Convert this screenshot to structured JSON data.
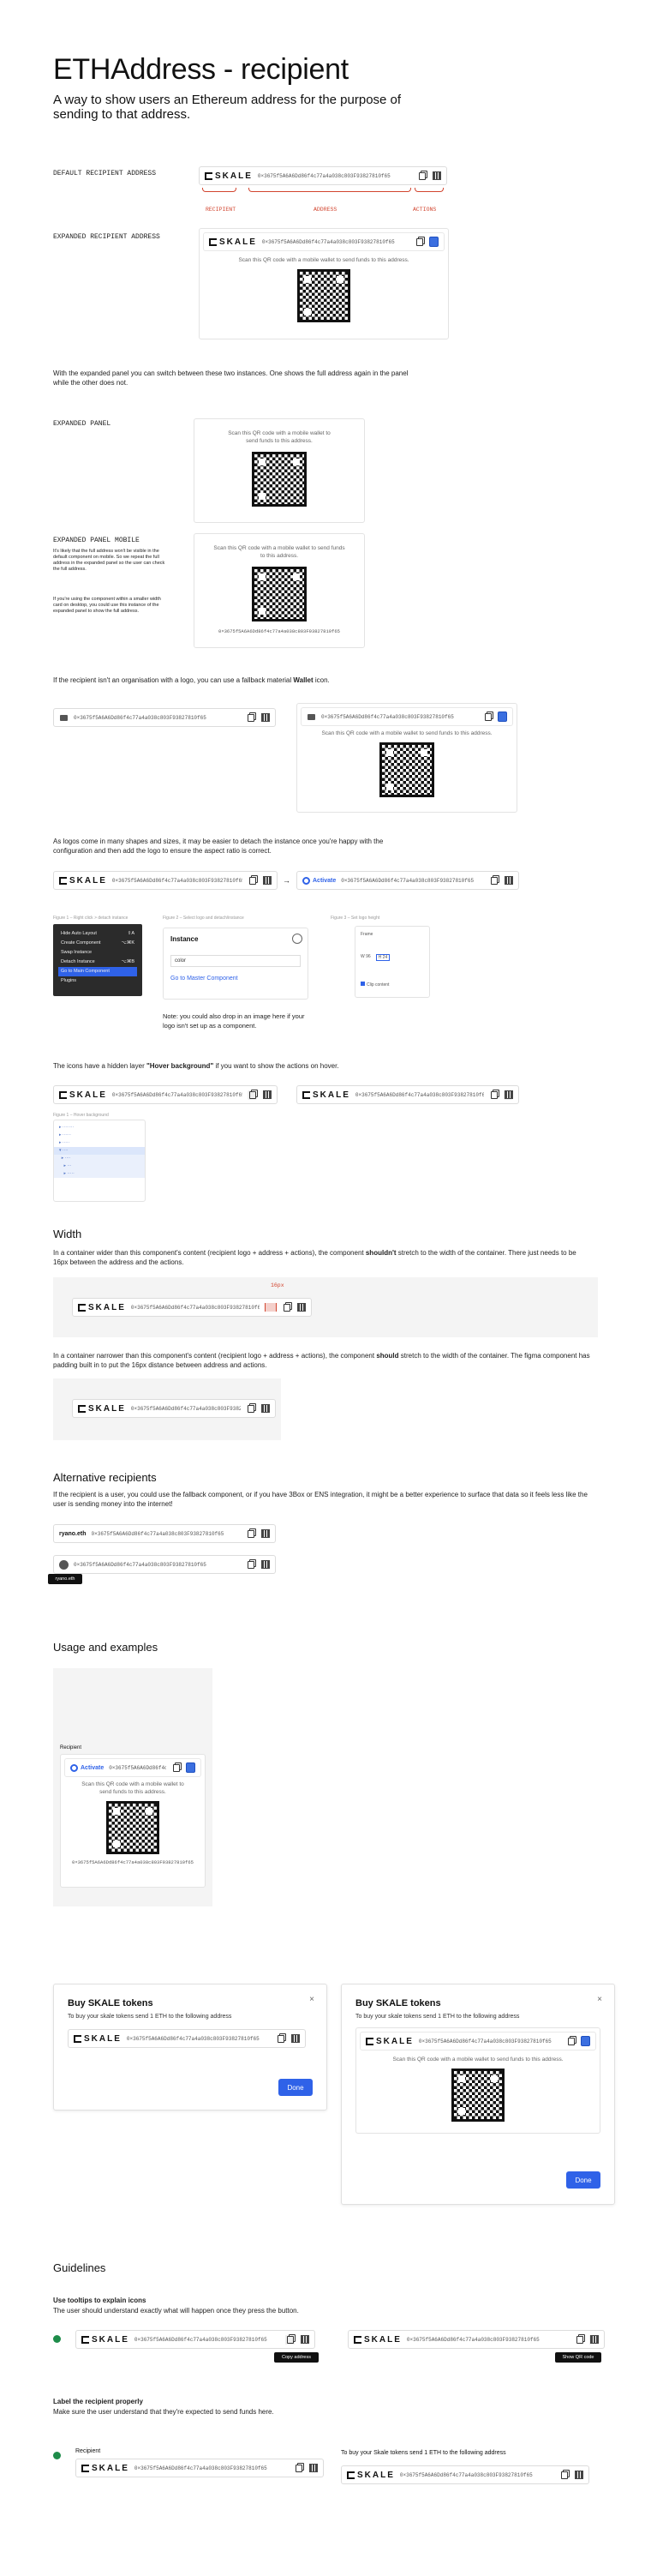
{
  "title": "ETHAddress - recipient",
  "subtitle": "A way to show users an Ethereum address for the purpose of sending to that address.",
  "address": "0×3675f5A6A6Dd86f4c77a4a038c803F93827810f65",
  "address_short": "0×3675f5A6A6Dd86f4c77a4a038c803F",
  "address_mid": "0×3675f5A6A6Dd86f4c77a4a038c803F938278",
  "logo_text": "SKALE",
  "qr_text": "Scan this QR code with a mobile wallet to send funds to this address.",
  "labels": {
    "default": "DEFAULT RECIPIENT ADDRESS",
    "expanded": "EXPANDED RECIPIENT ADDRESS",
    "recipient": "RECIPIENT",
    "address": "ADDRESS",
    "actions": "ACTIONS",
    "expanded_panel": "EXPANDED PANEL",
    "expanded_mobile": "EXPANDED PANEL MOBILE"
  },
  "text": {
    "switch": "With the expanded panel you can switch between these two instances. One shows the full address again in the panel while the other does not.",
    "mobile_note1": "It's likely that the full address won't be visible in the default component on mobile. So we repeat the full address in the expanded panel so the user can check the full address.",
    "mobile_note2": "If you're using the component within a smaller width card on desktop, you could use this instance of the expanded panel to show the full address.",
    "wallet_pre": "If the recipient isn't an organisation with a logo, you can use a fallback material ",
    "wallet_bold": "Wallet",
    "wallet_post": " icon.",
    "logos": "As logos come in many shapes and sizes, it may be easier to detach the instance once you're happy with the configuration and then add the logo to ensure the aspect ratio is correct.",
    "hover_pre": "The icons have a hidden layer ",
    "hover_bold": "\"Hover background\"",
    "hover_post": " if you want to show the actions on hover.",
    "width_p1_pre": "In a container wider than this component's content (recipient logo + address + actions), the component ",
    "width_p1_bold": "shouldn't",
    "width_p1_post": " stretch to the width of the container. There just needs to be 16px between the address and the actions.",
    "width_p2_pre": "In a container narrower than this component's content (recipient logo + address + actions), the component ",
    "width_p2_bold": "should",
    "width_p2_post": " stretch to the width of the container. The figma component has padding built in to put the 16px distance between address and actions.",
    "alt": "If the recipient is a user, you could use the fallback component, or if you have 3Box or ENS integration, it might be a better experience to surface that data so it feels less like the user is sending money into the internet!",
    "dropin": "Note: you could also drop in an image here if your logo isn't set up as a component.",
    "tooltips_h": "Use tooltips to explain icons",
    "tooltips_p": "The user should understand exactly what will happen once they press the button.",
    "label_h": "Label the recipient properly",
    "label_p": "Make sure the user understand that they're expected to send funds here.",
    "buy_body": "To buy your skale tokens send 1 ETH to the following address",
    "buy_body2": "To buy your Skale tokens send 1 ETH to the following address"
  },
  "headings": {
    "width": "Width",
    "alt": "Alternative recipients",
    "usage": "Usage and examples",
    "guide": "Guidelines"
  },
  "figures": {
    "f1": "Figure 1 – Right click > detach instance",
    "f2": "Figure 2 – Select logo and detach/instance",
    "f3": "Figure 3 – Set logo height",
    "f4": "Figure 1 – Hover background"
  },
  "menu": [
    "Hide Auto Layout",
    "Create Component",
    "Swap Instance",
    "Detach Instance",
    "Go to Main Component",
    "Plugins"
  ],
  "menu_keys": [
    "⇧A",
    "⌥⌘K",
    "",
    "⌥⌘B",
    "",
    ""
  ],
  "instance": {
    "title": "Instance",
    "select": "color",
    "link": "Go to Master Component"
  },
  "frame": {
    "title": "Frame",
    "w": "W 96",
    "h": "H 24",
    "clip": "Clip content"
  },
  "ens": "ryano.eth",
  "ens_tip": "ryano.eth",
  "measure": "16px",
  "recipient_label": "Recipient",
  "activate": "Activate",
  "modal_title": "Buy SKALE tokens",
  "done": "Done",
  "tip_copy": "Copy address",
  "tip_qr": "Show QR code",
  "colors": {
    "accent": "#2f62e8",
    "annotation": "#d2452f",
    "success": "#1e8c4a"
  }
}
